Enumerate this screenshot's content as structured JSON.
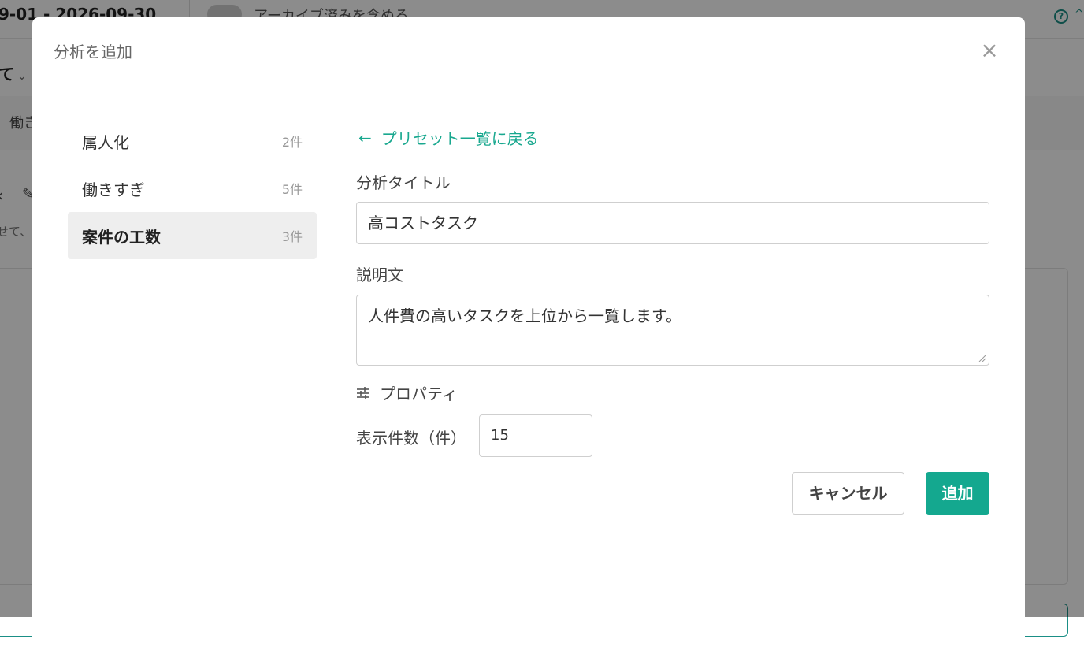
{
  "background": {
    "date_range": "9-01 - 2026-09-30",
    "archive_toggle_label": "アーカイブ済みを含める",
    "filter_label": "て",
    "tab_label": "働き",
    "description_snippet": "せて、"
  },
  "modal": {
    "title": "分析を追加",
    "close_icon": "×",
    "presets": [
      {
        "name": "属人化",
        "count": "2件"
      },
      {
        "name": "働きすぎ",
        "count": "5件"
      },
      {
        "name": "案件の工数",
        "count": "3件"
      }
    ],
    "back_link": "プリセット一覧に戻る",
    "title_label": "分析タイトル",
    "title_value": "高コストタスク",
    "description_label": "説明文",
    "description_value": "人件費の高いタスクを上位から一覧します。",
    "properties_heading": "プロパティ",
    "count_label": "表示件数（件）",
    "count_value": "15",
    "cancel_label": "キャンセル",
    "add_label": "追加"
  },
  "colors": {
    "accent": "#14a88f",
    "overlay": "rgba(0,0,0,0.45)"
  }
}
